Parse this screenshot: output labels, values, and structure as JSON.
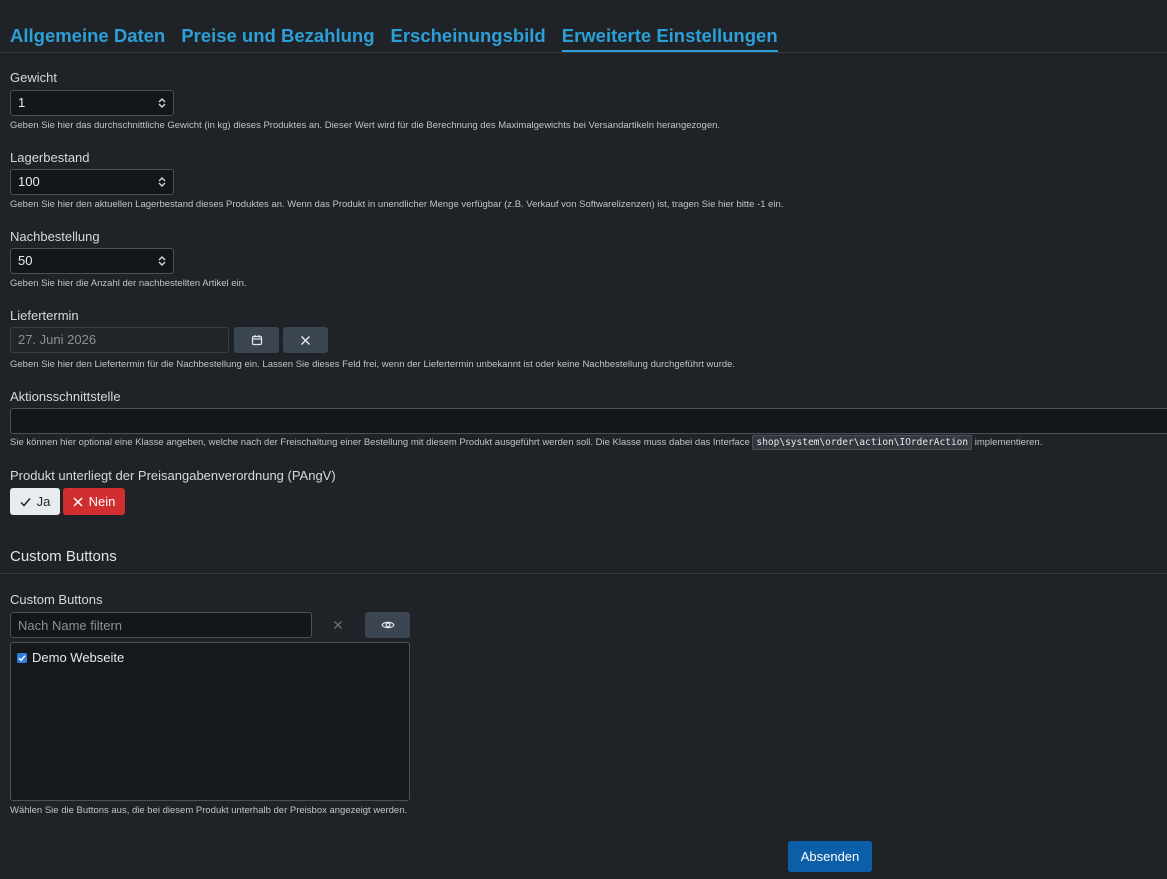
{
  "tabs": [
    {
      "label": "Allgemeine Daten"
    },
    {
      "label": "Preise und Bezahlung"
    },
    {
      "label": "Erscheinungsbild"
    },
    {
      "label": "Erweiterte Einstellungen"
    }
  ],
  "weight": {
    "label": "Gewicht",
    "value": "1",
    "help": "Geben Sie hier das durchschnittliche Gewicht (in kg) dieses Produktes an. Dieser Wert wird für die Berechnung des Maximalgewichts bei Versandartikeln herangezogen."
  },
  "stock": {
    "label": "Lagerbestand",
    "value": "100",
    "help": "Geben Sie hier den aktuellen Lagerbestand dieses Produktes an. Wenn das Produkt in unendlicher Menge verfügbar (z.B. Verkauf von Softwarelizenzen) ist, tragen Sie hier bitte -1 ein."
  },
  "reorder": {
    "label": "Nachbestellung",
    "value": "50",
    "help": "Geben Sie hier die Anzahl der nachbestellten Artikel ein."
  },
  "delivery": {
    "label": "Liefertermin",
    "value": "27. Juni 2026",
    "help": "Geben Sie hier den Liefertermin für die Nachbestellung ein. Lassen Sie dieses Feld frei, wenn der Liefertermin unbekannt ist oder keine Nachbestellung durchgeführt wurde."
  },
  "action": {
    "label": "Aktionsschnittstelle",
    "value": "",
    "help_before": "Sie können hier optional eine Klasse angeben, welche nach der Freischaltung einer Bestellung mit diesem Produkt ausgeführt werden soll. Die Klasse muss dabei das Interface ",
    "help_code": "shop\\system\\order\\action\\IOrderAction",
    "help_after": " implementieren."
  },
  "pangv": {
    "label": "Produkt unterliegt der Preisangabenverordnung (PAngV)",
    "yes": "Ja",
    "no": "Nein"
  },
  "custom_buttons": {
    "section_title": "Custom Buttons",
    "label": "Custom Buttons",
    "filter_placeholder": "Nach Name filtern",
    "items": [
      {
        "label": "Demo Webseite",
        "checked": true
      }
    ],
    "help": "Wählen Sie die Buttons aus, die bei diesem Produkt unterhalb der Preisbox angezeigt werden."
  },
  "submit_label": "Absenden",
  "colors": {
    "background": "#1f2327",
    "accent": "#2b9fd6",
    "danger": "#d12f2f",
    "primary": "#0b5ea8"
  }
}
